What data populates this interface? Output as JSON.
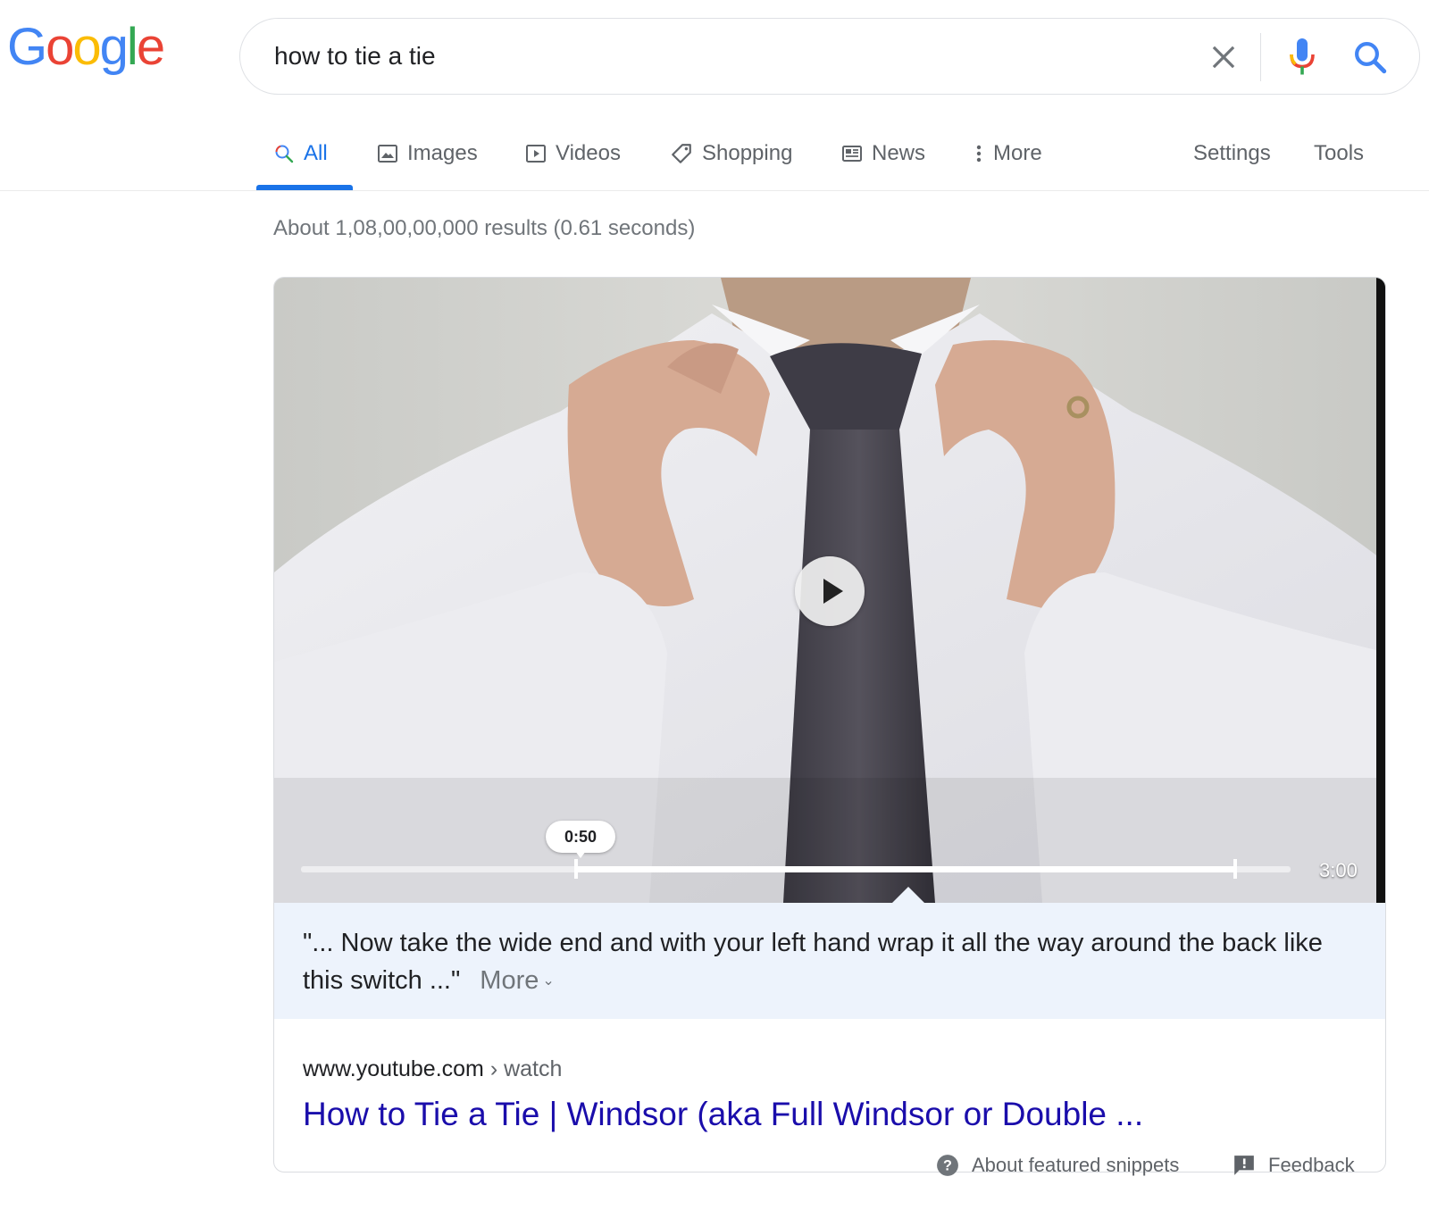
{
  "logo": {
    "letters": [
      "G",
      "o",
      "o",
      "g",
      "l",
      "e"
    ],
    "colors": [
      "#4285F4",
      "#EA4335",
      "#FBBC05",
      "#4285F4",
      "#34A853",
      "#EA4335"
    ]
  },
  "search": {
    "query": "how to tie a tie"
  },
  "tabs": [
    {
      "label": "All",
      "icon": "search-icon"
    },
    {
      "label": "Images",
      "icon": "image-icon"
    },
    {
      "label": "Videos",
      "icon": "play-box-icon"
    },
    {
      "label": "Shopping",
      "icon": "tag-icon"
    },
    {
      "label": "News",
      "icon": "newspaper-icon"
    },
    {
      "label": "More",
      "icon": "vertical-dots-icon"
    },
    {
      "label": "Settings"
    },
    {
      "label": "Tools"
    }
  ],
  "stats": "About 1,08,00,00,000 results (0.61 seconds)",
  "video": {
    "current_time": "0:50",
    "duration": "3:00",
    "highlight_start_fraction": 0.278,
    "highlight_end_fraction": 0.944
  },
  "snippet": {
    "quote": "\"... Now take the wide end and with your left hand wrap it all the way around the back like this switch ...\"",
    "more_label": "More",
    "site": "www.youtube.com",
    "breadcrumb": " › watch",
    "title": "How to Tie a Tie | Windsor (aka Full Windsor or Double ..."
  },
  "footer": {
    "about_label": "About featured snippets",
    "feedback_label": "Feedback"
  },
  "colors": {
    "accent": "#1a73e8",
    "link": "#1a0dab",
    "snippet_bg": "#edf3fc"
  }
}
